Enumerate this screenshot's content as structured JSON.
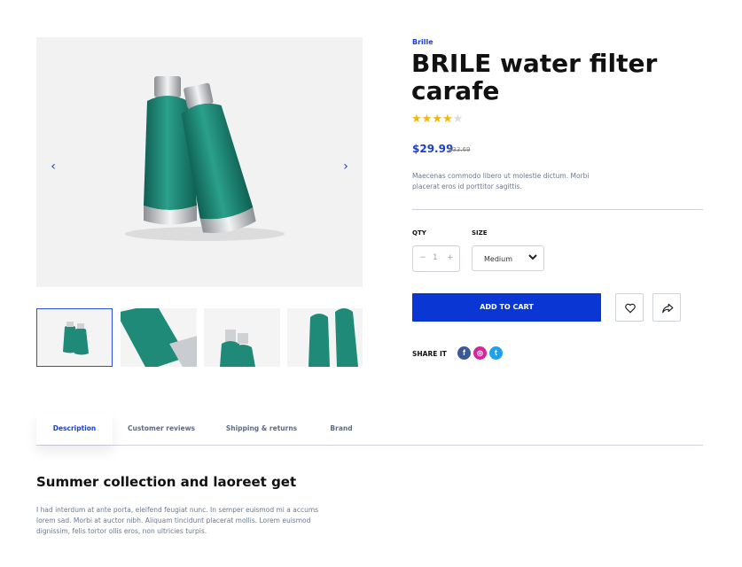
{
  "product": {
    "brand": "Brille",
    "title": "BRILE water filter carafe",
    "rating": {
      "value": 4,
      "max": 5
    },
    "price": "$29.99",
    "old_price": "$33.69",
    "description": "Maecenas commodo libero ut molestie dictum. Morbi placerat eros id porttitor sagittis."
  },
  "gallery": {
    "prev_icon": "chevron-left-icon",
    "next_icon": "chevron-right-icon",
    "thumbnails": [
      "thumb-1",
      "thumb-2",
      "thumb-3",
      "thumb-4"
    ]
  },
  "options": {
    "qty_label": "QTY",
    "qty_minus": "−",
    "qty_value": "1",
    "qty_plus": "+",
    "size_label": "SIZE",
    "size_value": "Medium"
  },
  "actions": {
    "add_to_cart": "ADD TO CART",
    "wishlist_icon": "heart-icon",
    "share_icon": "share-icon"
  },
  "share": {
    "label": "SHARE IT",
    "networks": [
      {
        "name": "facebook",
        "glyph": "f",
        "color": "#3b5998"
      },
      {
        "name": "instagram",
        "glyph": "◎",
        "color": "#d6249f"
      },
      {
        "name": "twitter",
        "glyph": "t",
        "color": "#1da1f2"
      }
    ]
  },
  "tabs": [
    "Description",
    "Customer reviews",
    "Shipping & returns",
    "Brand"
  ],
  "section": {
    "title": "Summer collection and laoreet get",
    "text": "I had interdum at ante porta, eleifend feugiat nunc. In semper euismod mi a accums lorem sad. Morbi at auctor nibh. Aliquam tincidunt placerat mollis. Lorem euismod dignissim, felis tortor ollis eros, non ultricies turpis."
  },
  "colors": {
    "accent": "#0a36d4",
    "bottle": "#1f8a78",
    "star": "#f5b800"
  }
}
